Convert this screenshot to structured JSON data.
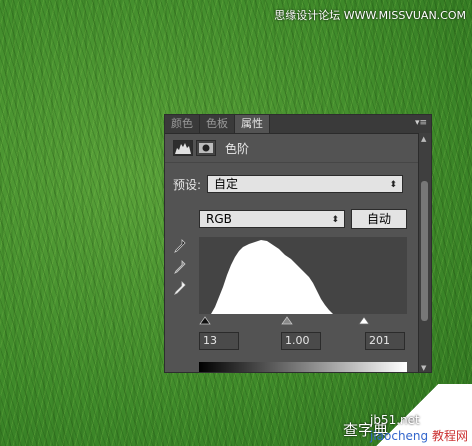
{
  "watermark": {
    "top": "思缘设计论坛 WWW.MISSVUAN.COM",
    "site": "jb51.net",
    "site_prefix": "jiaocheng",
    "site_name": "教程网",
    "brand": "查字典"
  },
  "tabs": [
    {
      "label": "颜色",
      "active": false
    },
    {
      "label": "色板",
      "active": false
    },
    {
      "label": "属性",
      "active": true
    }
  ],
  "header": {
    "title": "色阶",
    "icons": [
      "levels-icon",
      "mask-icon"
    ]
  },
  "preset": {
    "label": "预设:",
    "value": "自定"
  },
  "channel": {
    "value": "RGB"
  },
  "auto_button": "自动",
  "eyedroppers": [
    "black-point-eyedropper-icon",
    "gray-point-eyedropper-icon",
    "white-point-eyedropper-icon"
  ],
  "input_levels": {
    "black": "13",
    "gamma": "1.00",
    "white": "201"
  },
  "colors": {
    "panel": "#535353",
    "tab_bar": "#3a3a3a",
    "histogram_bg": "#444444",
    "histogram_fill": "#ffffff"
  }
}
